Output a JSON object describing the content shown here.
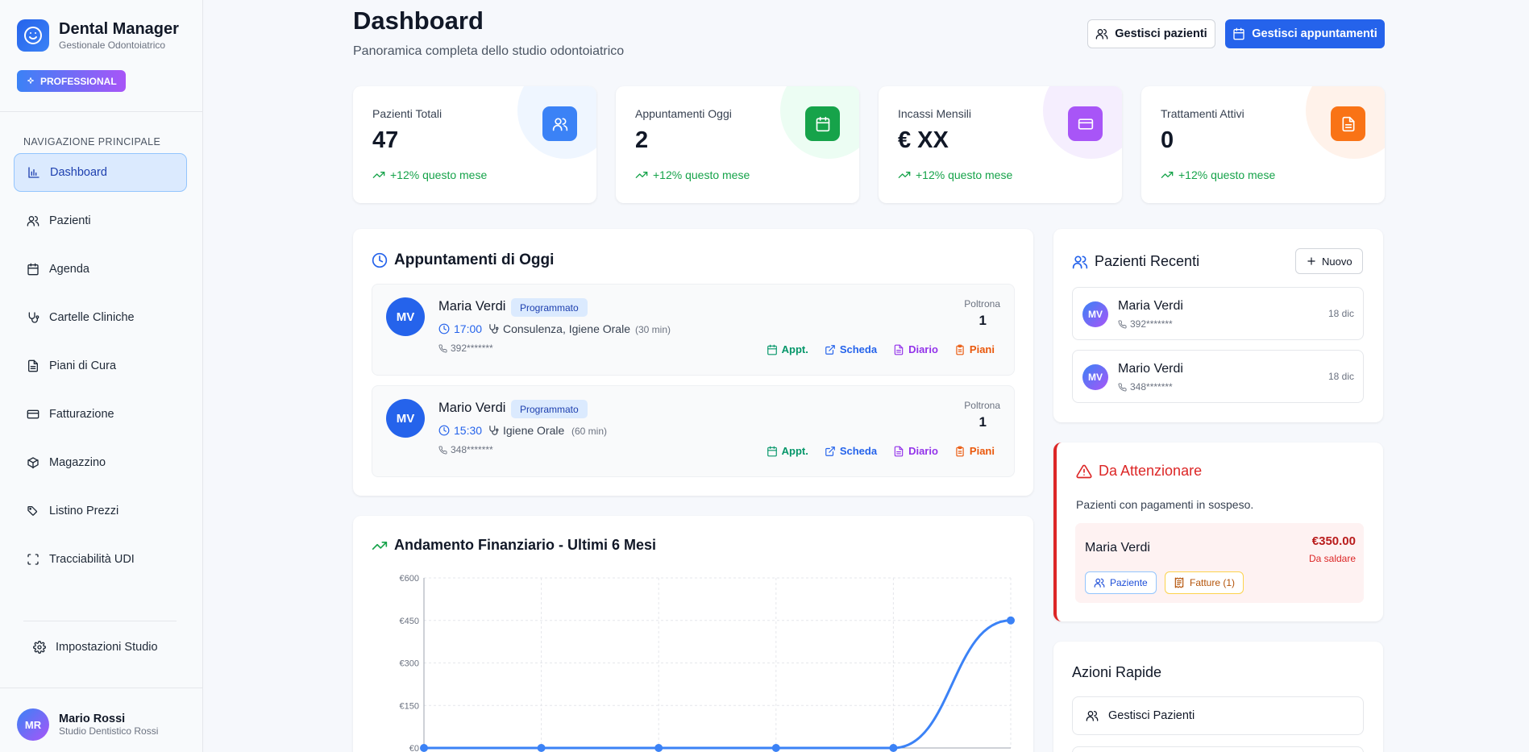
{
  "brand": {
    "title": "Dental Manager",
    "subtitle": "Gestionale Odontoiatrico",
    "plan": "PROFESSIONAL"
  },
  "nav": {
    "section_title": "NAVIGAZIONE PRINCIPALE",
    "items": [
      {
        "label": "Dashboard",
        "icon": "bar-chart-icon",
        "active": true
      },
      {
        "label": "Pazienti",
        "icon": "users-icon"
      },
      {
        "label": "Agenda",
        "icon": "calendar-icon"
      },
      {
        "label": "Cartelle Cliniche",
        "icon": "stethoscope-icon"
      },
      {
        "label": "Piani di Cura",
        "icon": "file-icon"
      },
      {
        "label": "Fatturazione",
        "icon": "credit-card-icon"
      },
      {
        "label": "Magazzino",
        "icon": "package-icon"
      },
      {
        "label": "Listino Prezzi",
        "icon": "tags-icon"
      },
      {
        "label": "Tracciabilità UDI",
        "icon": "scan-icon"
      }
    ],
    "settings": "Impostazioni Studio"
  },
  "user": {
    "initials": "MR",
    "name": "Mario Rossi",
    "studio": "Studio Dentistico Rossi"
  },
  "header": {
    "title": "Dashboard",
    "subtitle": "Panoramica completa dello studio odontoiatrico",
    "btn_patients": "Gestisci pazienti",
    "btn_appointments": "Gestisci appuntamenti"
  },
  "stats": [
    {
      "label": "Pazienti Totali",
      "value": "47",
      "trend": "+12% questo mese",
      "color": "#3b82f6"
    },
    {
      "label": "Appuntamenti Oggi",
      "value": "2",
      "trend": "+12% questo mese",
      "color": "#16a34a"
    },
    {
      "label": "Incassi Mensili",
      "value": "€ XX",
      "trend": "+12% questo mese",
      "color": "#a855f7"
    },
    {
      "label": "Trattamenti Attivi",
      "value": "0",
      "trend": "+12% questo mese",
      "color": "#f97316"
    }
  ],
  "appointments": {
    "title": "Appuntamenti di Oggi",
    "chair_label": "Poltrona",
    "actions": {
      "appt": "Appt.",
      "scheda": "Scheda",
      "diario": "Diario",
      "piani": "Piani"
    },
    "items": [
      {
        "initials": "MV",
        "name": "Maria Verdi",
        "status": "Programmato",
        "time": "17:00",
        "treatment": "Consulenza, Igiene Orale",
        "duration": "(30 min)",
        "phone": "392*******",
        "chair": "1"
      },
      {
        "initials": "MV",
        "name": "Mario Verdi",
        "status": "Programmato",
        "time": "15:30",
        "treatment": "Igiene Orale",
        "duration": "(60 min)",
        "phone": "348*******",
        "chair": "1"
      }
    ]
  },
  "recent": {
    "title": "Pazienti Recenti",
    "new_label": "Nuovo",
    "items": [
      {
        "initials": "MV",
        "name": "Maria Verdi",
        "phone": "392*******",
        "date": "18 dic"
      },
      {
        "initials": "MV",
        "name": "Mario Verdi",
        "phone": "348*******",
        "date": "18 dic"
      }
    ]
  },
  "attention": {
    "title": "Da Attenzionare",
    "description": "Pazienti con pagamenti in sospeso.",
    "patient": "Maria Verdi",
    "amount": "€350.00",
    "amount_status": "Da saldare",
    "btn_patient": "Paziente",
    "btn_invoices": "Fatture (1)"
  },
  "quick_actions": {
    "title": "Azioni Rapide",
    "items": [
      "Gestisci Pazienti"
    ]
  },
  "chart_data": {
    "type": "line",
    "title": "Andamento Finanziario - Ultimi 6 Mesi",
    "x": [
      1,
      2,
      3,
      4,
      5,
      6
    ],
    "series": [
      {
        "values": [
          0,
          0,
          0,
          0,
          0,
          450
        ]
      }
    ],
    "ylim": [
      0,
      600
    ],
    "yticks": [
      "€600",
      "€450",
      "€300",
      "€150",
      "€0"
    ],
    "ytick_values": [
      600,
      450,
      300,
      150,
      0
    ],
    "grid": true,
    "color": "#3b82f6"
  }
}
